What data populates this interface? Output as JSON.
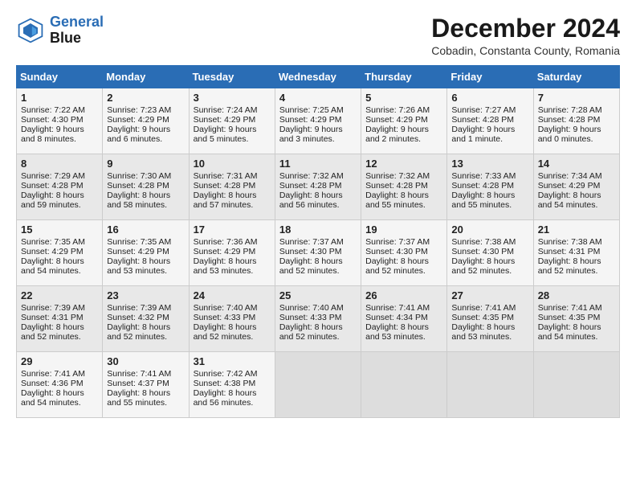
{
  "header": {
    "logo_line1": "General",
    "logo_line2": "Blue",
    "month_title": "December 2024",
    "location": "Cobadin, Constanta County, Romania"
  },
  "columns": [
    "Sunday",
    "Monday",
    "Tuesday",
    "Wednesday",
    "Thursday",
    "Friday",
    "Saturday"
  ],
  "weeks": [
    [
      {
        "day": "1",
        "lines": [
          "Sunrise: 7:22 AM",
          "Sunset: 4:30 PM",
          "Daylight: 9 hours",
          "and 8 minutes."
        ]
      },
      {
        "day": "2",
        "lines": [
          "Sunrise: 7:23 AM",
          "Sunset: 4:29 PM",
          "Daylight: 9 hours",
          "and 6 minutes."
        ]
      },
      {
        "day": "3",
        "lines": [
          "Sunrise: 7:24 AM",
          "Sunset: 4:29 PM",
          "Daylight: 9 hours",
          "and 5 minutes."
        ]
      },
      {
        "day": "4",
        "lines": [
          "Sunrise: 7:25 AM",
          "Sunset: 4:29 PM",
          "Daylight: 9 hours",
          "and 3 minutes."
        ]
      },
      {
        "day": "5",
        "lines": [
          "Sunrise: 7:26 AM",
          "Sunset: 4:29 PM",
          "Daylight: 9 hours",
          "and 2 minutes."
        ]
      },
      {
        "day": "6",
        "lines": [
          "Sunrise: 7:27 AM",
          "Sunset: 4:28 PM",
          "Daylight: 9 hours",
          "and 1 minute."
        ]
      },
      {
        "day": "7",
        "lines": [
          "Sunrise: 7:28 AM",
          "Sunset: 4:28 PM",
          "Daylight: 9 hours",
          "and 0 minutes."
        ]
      }
    ],
    [
      {
        "day": "8",
        "lines": [
          "Sunrise: 7:29 AM",
          "Sunset: 4:28 PM",
          "Daylight: 8 hours",
          "and 59 minutes."
        ]
      },
      {
        "day": "9",
        "lines": [
          "Sunrise: 7:30 AM",
          "Sunset: 4:28 PM",
          "Daylight: 8 hours",
          "and 58 minutes."
        ]
      },
      {
        "day": "10",
        "lines": [
          "Sunrise: 7:31 AM",
          "Sunset: 4:28 PM",
          "Daylight: 8 hours",
          "and 57 minutes."
        ]
      },
      {
        "day": "11",
        "lines": [
          "Sunrise: 7:32 AM",
          "Sunset: 4:28 PM",
          "Daylight: 8 hours",
          "and 56 minutes."
        ]
      },
      {
        "day": "12",
        "lines": [
          "Sunrise: 7:32 AM",
          "Sunset: 4:28 PM",
          "Daylight: 8 hours",
          "and 55 minutes."
        ]
      },
      {
        "day": "13",
        "lines": [
          "Sunrise: 7:33 AM",
          "Sunset: 4:28 PM",
          "Daylight: 8 hours",
          "and 55 minutes."
        ]
      },
      {
        "day": "14",
        "lines": [
          "Sunrise: 7:34 AM",
          "Sunset: 4:29 PM",
          "Daylight: 8 hours",
          "and 54 minutes."
        ]
      }
    ],
    [
      {
        "day": "15",
        "lines": [
          "Sunrise: 7:35 AM",
          "Sunset: 4:29 PM",
          "Daylight: 8 hours",
          "and 54 minutes."
        ]
      },
      {
        "day": "16",
        "lines": [
          "Sunrise: 7:35 AM",
          "Sunset: 4:29 PM",
          "Daylight: 8 hours",
          "and 53 minutes."
        ]
      },
      {
        "day": "17",
        "lines": [
          "Sunrise: 7:36 AM",
          "Sunset: 4:29 PM",
          "Daylight: 8 hours",
          "and 53 minutes."
        ]
      },
      {
        "day": "18",
        "lines": [
          "Sunrise: 7:37 AM",
          "Sunset: 4:30 PM",
          "Daylight: 8 hours",
          "and 52 minutes."
        ]
      },
      {
        "day": "19",
        "lines": [
          "Sunrise: 7:37 AM",
          "Sunset: 4:30 PM",
          "Daylight: 8 hours",
          "and 52 minutes."
        ]
      },
      {
        "day": "20",
        "lines": [
          "Sunrise: 7:38 AM",
          "Sunset: 4:30 PM",
          "Daylight: 8 hours",
          "and 52 minutes."
        ]
      },
      {
        "day": "21",
        "lines": [
          "Sunrise: 7:38 AM",
          "Sunset: 4:31 PM",
          "Daylight: 8 hours",
          "and 52 minutes."
        ]
      }
    ],
    [
      {
        "day": "22",
        "lines": [
          "Sunrise: 7:39 AM",
          "Sunset: 4:31 PM",
          "Daylight: 8 hours",
          "and 52 minutes."
        ]
      },
      {
        "day": "23",
        "lines": [
          "Sunrise: 7:39 AM",
          "Sunset: 4:32 PM",
          "Daylight: 8 hours",
          "and 52 minutes."
        ]
      },
      {
        "day": "24",
        "lines": [
          "Sunrise: 7:40 AM",
          "Sunset: 4:33 PM",
          "Daylight: 8 hours",
          "and 52 minutes."
        ]
      },
      {
        "day": "25",
        "lines": [
          "Sunrise: 7:40 AM",
          "Sunset: 4:33 PM",
          "Daylight: 8 hours",
          "and 52 minutes."
        ]
      },
      {
        "day": "26",
        "lines": [
          "Sunrise: 7:41 AM",
          "Sunset: 4:34 PM",
          "Daylight: 8 hours",
          "and 53 minutes."
        ]
      },
      {
        "day": "27",
        "lines": [
          "Sunrise: 7:41 AM",
          "Sunset: 4:35 PM",
          "Daylight: 8 hours",
          "and 53 minutes."
        ]
      },
      {
        "day": "28",
        "lines": [
          "Sunrise: 7:41 AM",
          "Sunset: 4:35 PM",
          "Daylight: 8 hours",
          "and 54 minutes."
        ]
      }
    ],
    [
      {
        "day": "29",
        "lines": [
          "Sunrise: 7:41 AM",
          "Sunset: 4:36 PM",
          "Daylight: 8 hours",
          "and 54 minutes."
        ]
      },
      {
        "day": "30",
        "lines": [
          "Sunrise: 7:41 AM",
          "Sunset: 4:37 PM",
          "Daylight: 8 hours",
          "and 55 minutes."
        ]
      },
      {
        "day": "31",
        "lines": [
          "Sunrise: 7:42 AM",
          "Sunset: 4:38 PM",
          "Daylight: 8 hours",
          "and 56 minutes."
        ]
      },
      null,
      null,
      null,
      null
    ]
  ]
}
